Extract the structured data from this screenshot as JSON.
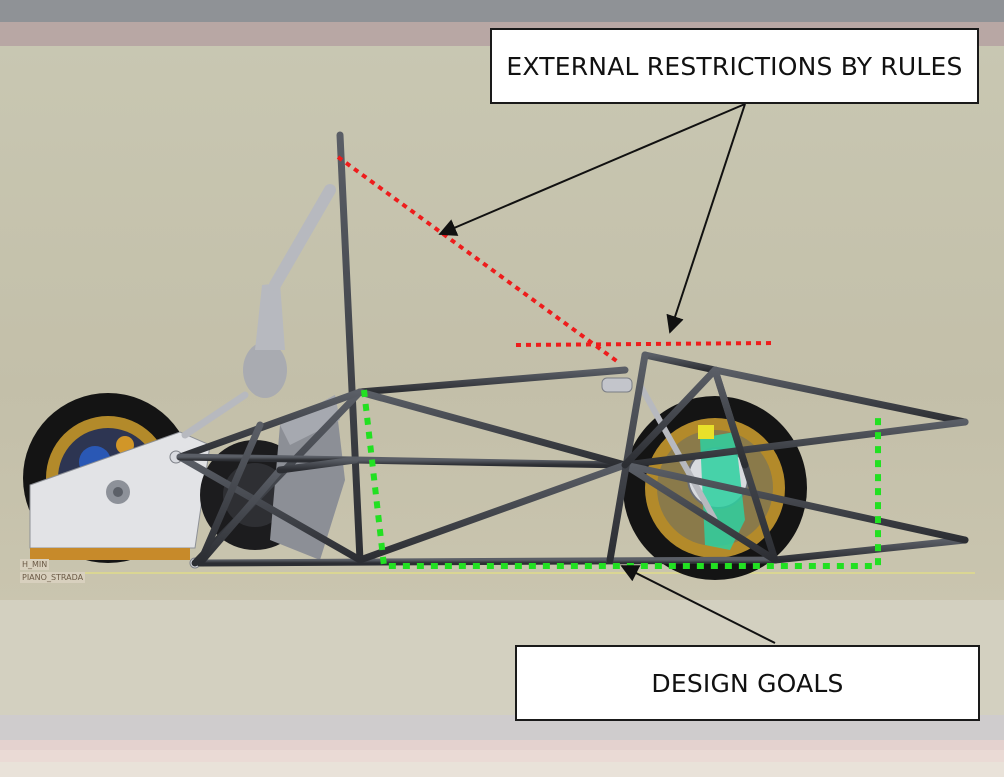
{
  "annotations": {
    "external_restrictions": "EXTERNAL RESTRICTIONS BY RULES",
    "design_goals": "DESIGN GOALS"
  },
  "cad_labels": {
    "h_min": "H_MIN",
    "piano_strada": "PIANO_STRADA"
  },
  "colors": {
    "restriction_line": "#ee1c1c",
    "goal_line": "#22e022",
    "frame_tube": "#3a3d42",
    "background": "#c6c2ae"
  },
  "icons": {
    "rear_wheel": "wheel",
    "front_wheel": "wheel",
    "arrows": "callout-arrow"
  }
}
